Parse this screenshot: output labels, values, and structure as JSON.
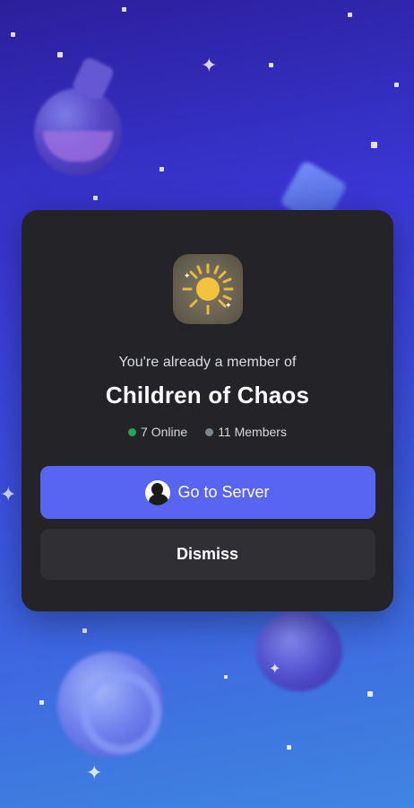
{
  "invite": {
    "subtitle": "You're already a member of",
    "server_name": "Children of Chaos",
    "online_count": "7 Online",
    "member_count": "11 Members",
    "server_icon": "sun-icon"
  },
  "actions": {
    "go_to_server_label": "Go to Server",
    "dismiss_label": "Dismiss"
  },
  "colors": {
    "accent": "#5865f2",
    "card": "#242428",
    "online": "#23a55a",
    "members": "#80848e"
  }
}
